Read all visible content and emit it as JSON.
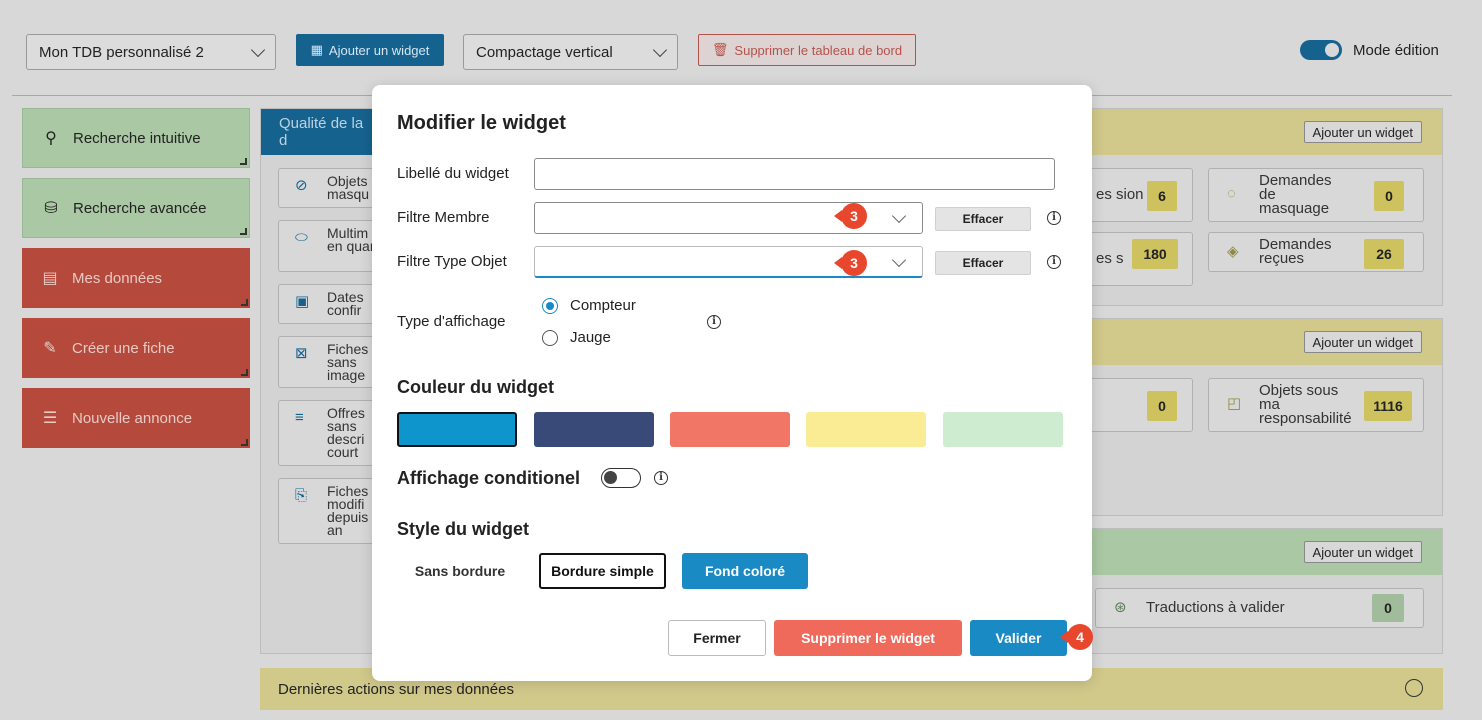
{
  "toolbar": {
    "dashboard_select": "Mon TDB personnalisé 2",
    "add_widget": "Ajouter un widget",
    "compaction_select": "Compactage vertical",
    "delete_board": "Supprimer le tableau de bord",
    "edit_mode_label": "Mode édition",
    "edit_mode_on": true
  },
  "sidebar": {
    "items": [
      {
        "label": "Recherche intuitive",
        "icon": "search-icon",
        "color": "#a9c8a3"
      },
      {
        "label": "Recherche avancée",
        "icon": "database-search-icon",
        "color": "#a9c8a3"
      },
      {
        "label": "Mes données",
        "icon": "data-icon",
        "color": "#b54a3c"
      },
      {
        "label": "Créer une fiche",
        "icon": "create-record-icon",
        "color": "#b54a3c"
      },
      {
        "label": "Nouvelle annonce",
        "icon": "announcement-icon",
        "color": "#b54a3c"
      }
    ]
  },
  "quality_panel": {
    "title": "Qualité de la d",
    "cards": [
      {
        "label": "Objets masqu",
        "icon": "hidden-object-icon"
      },
      {
        "label": "Multim en quara",
        "icon": "pill-icon"
      },
      {
        "label": "Dates confir",
        "icon": "calendar-check-icon"
      },
      {
        "label": "Fiches sans image",
        "icon": "no-image-icon"
      },
      {
        "label": "Offres sans descri court",
        "icon": "text-info-icon"
      },
      {
        "label": "Fiches modifi depuis an",
        "icon": "modified-record-icon"
      }
    ]
  },
  "right_panels": {
    "add_widget_label": "Ajouter un widget",
    "panel1": [
      {
        "label": "es sion",
        "count": "6"
      },
      {
        "label": "Demandes de masquage",
        "count": "0"
      },
      {
        "label": "es s",
        "count": "180"
      },
      {
        "label": "Demandes reçues",
        "count": "26"
      }
    ],
    "panel2": [
      {
        "label": "",
        "count": "0"
      },
      {
        "label": "Objets sous ma responsabilité",
        "count": "1116"
      }
    ],
    "panel3": [
      {
        "label": "Traductions à valider",
        "count": "0"
      }
    ]
  },
  "bottom_panel": {
    "title": "Dernières actions sur mes données"
  },
  "modal": {
    "title": "Modifier le widget",
    "fields": {
      "widget_label": {
        "label": "Libellé du widget",
        "value": ""
      },
      "member_filter": {
        "label": "Filtre Membre",
        "value": "",
        "clear": "Effacer",
        "badge": "3"
      },
      "object_type_filter": {
        "label": "Filtre Type Objet",
        "value": "",
        "clear": "Effacer",
        "badge": "3"
      }
    },
    "display_type": {
      "label": "Type d'affichage",
      "options": [
        "Compteur",
        "Jauge"
      ],
      "selected": "Compteur"
    },
    "color_section": {
      "title": "Couleur du widget",
      "swatches": [
        "#0e96cc",
        "#3a4a78",
        "#f27666",
        "#faec95",
        "#cdecd0"
      ],
      "selected_index": 0
    },
    "conditional": {
      "title": "Affichage conditionel",
      "enabled": false
    },
    "style_section": {
      "title": "Style du widget",
      "options": [
        "Sans bordure",
        "Bordure simple",
        "Fond coloré"
      ],
      "selected": "Fond coloré"
    },
    "buttons": {
      "close": "Fermer",
      "delete": "Supprimer le widget",
      "validate": "Valider",
      "validate_badge": "4"
    }
  }
}
